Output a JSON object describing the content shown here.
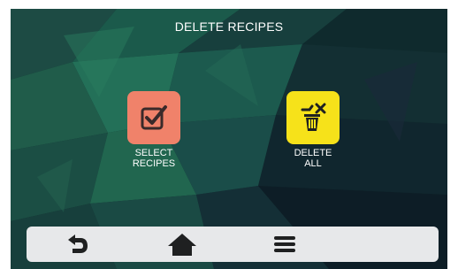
{
  "header": {
    "title": "DELETE RECIPES"
  },
  "actions": [
    {
      "id": "select",
      "label_line1": "SELECT",
      "label_line2": "RECIPES",
      "icon": "checkbox-check-icon",
      "color": "#f0826a"
    },
    {
      "id": "delete_all",
      "label_line1": "DELETE",
      "label_line2": "ALL",
      "icon": "trash-delete-icon",
      "color": "#f6e21a"
    }
  ],
  "navbar": {
    "items": [
      {
        "icon": "back-arrow-icon"
      },
      {
        "icon": "home-icon"
      },
      {
        "icon": "menu-icon"
      }
    ]
  },
  "colors": {
    "background": "#123a36",
    "navbar": "#e7e8ea",
    "icon_dark": "#1f2021"
  }
}
